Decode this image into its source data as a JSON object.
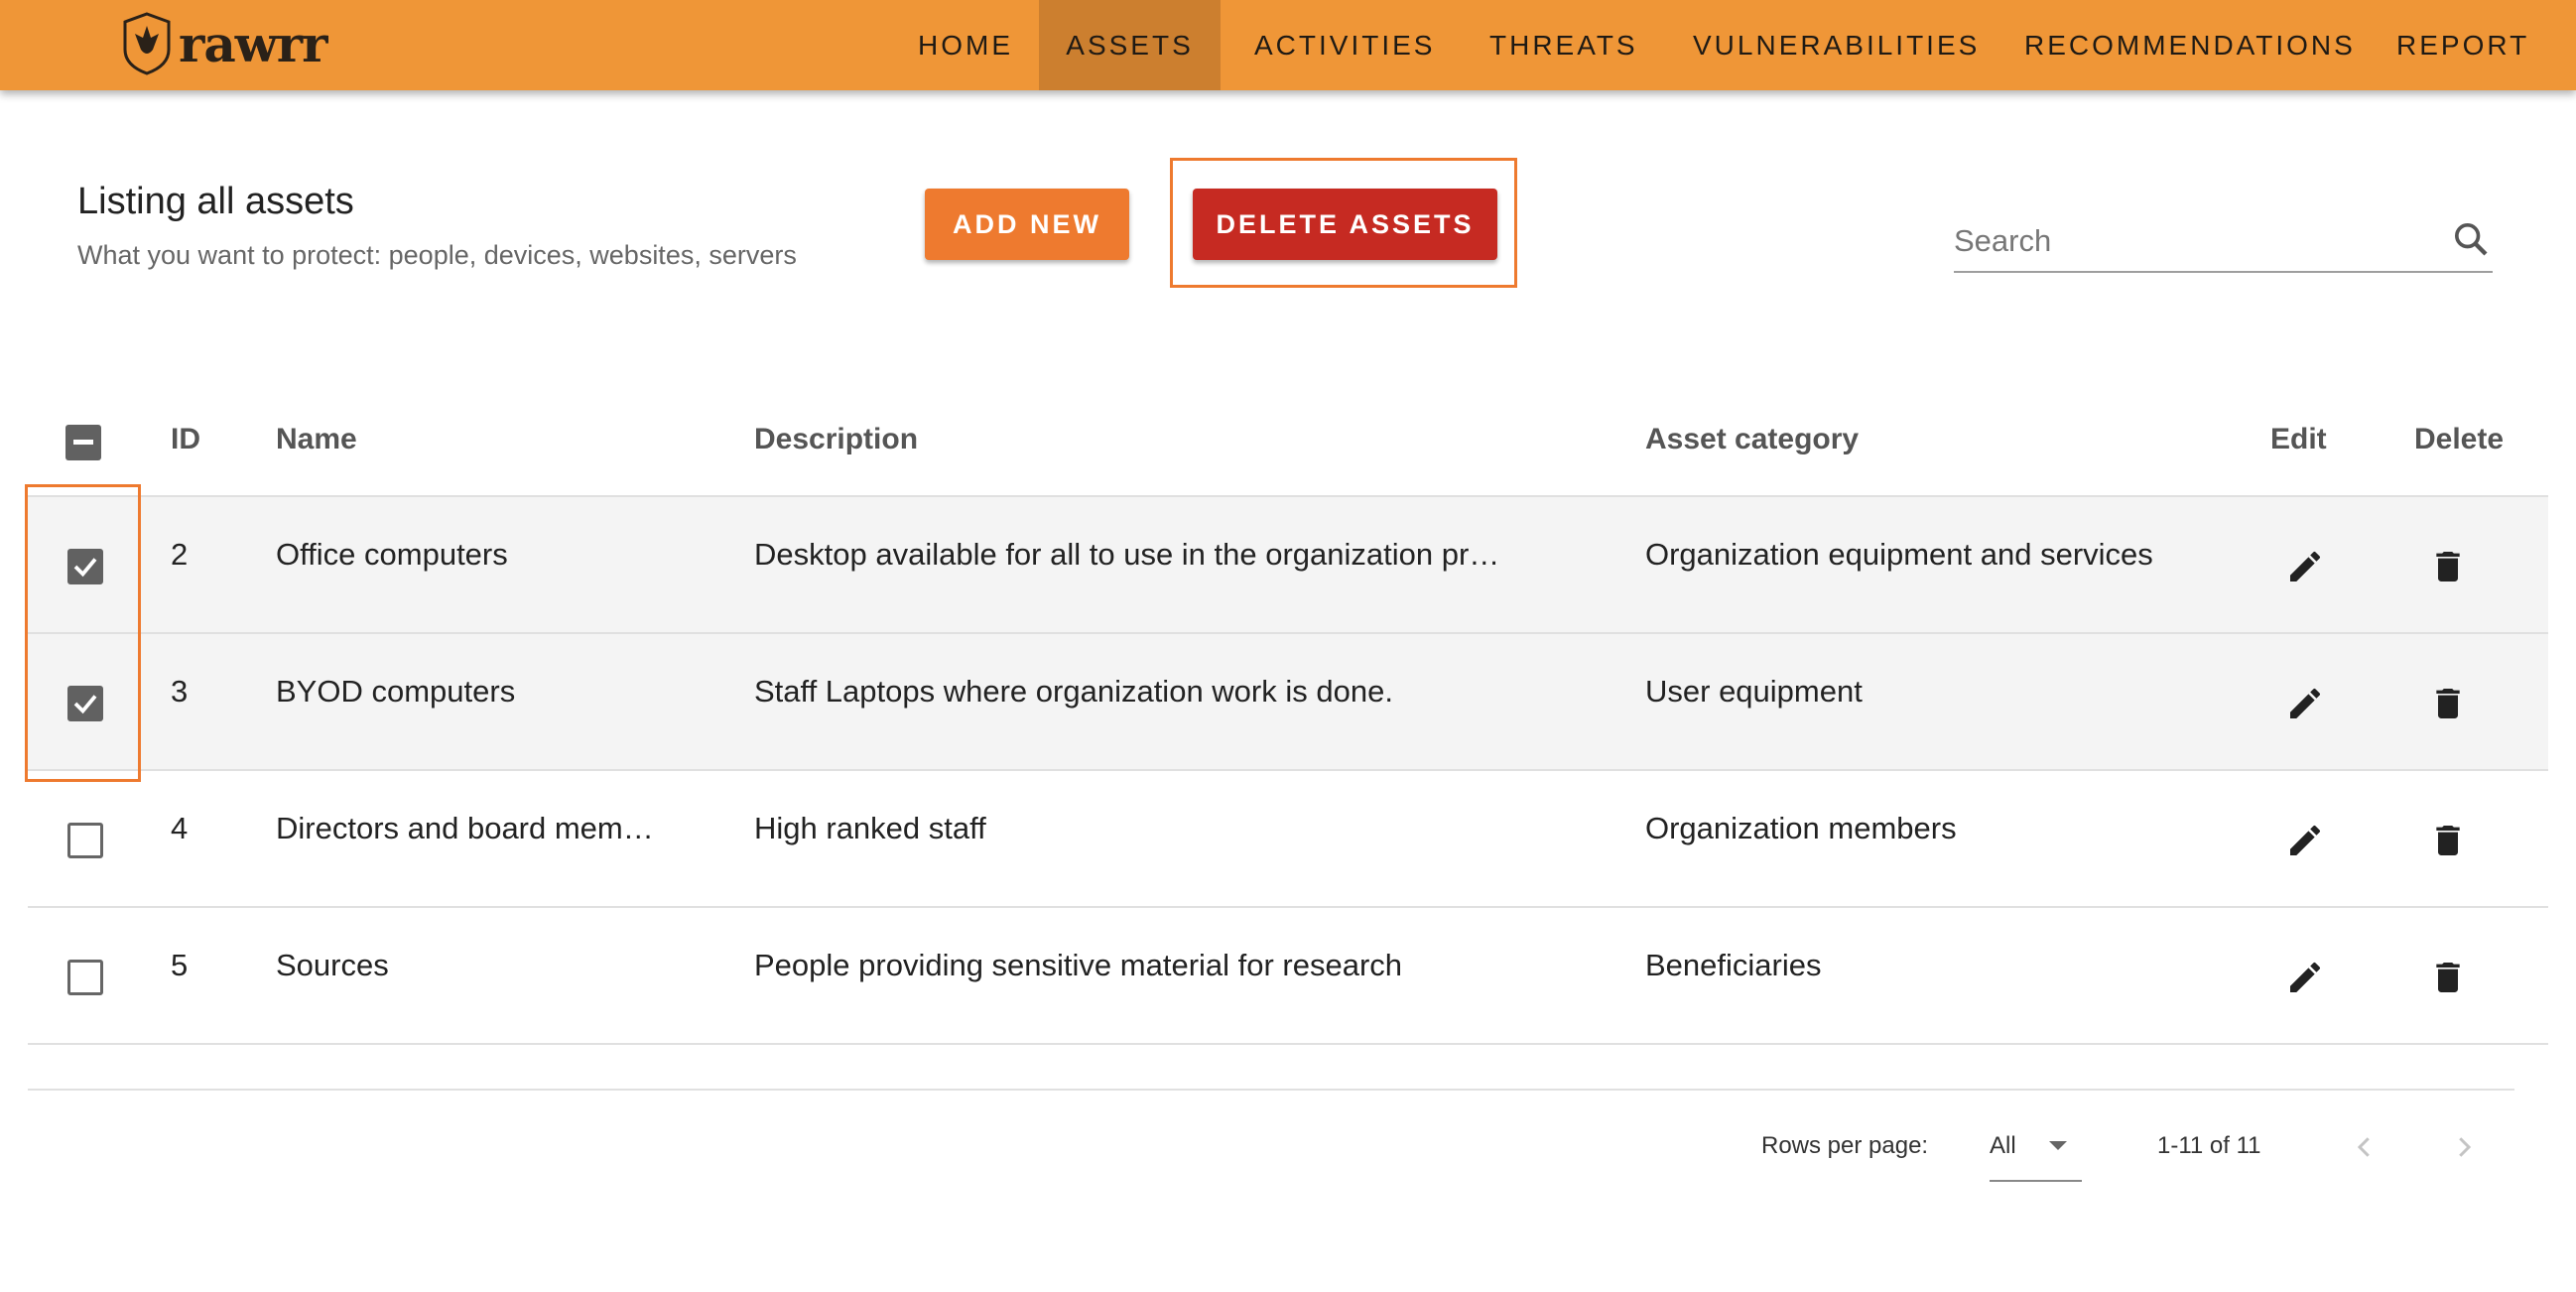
{
  "app": {
    "logo_text": "rawrr"
  },
  "nav": [
    {
      "label": "HOME"
    },
    {
      "label": "ASSETS",
      "active": true
    },
    {
      "label": "ACTIVITIES"
    },
    {
      "label": "THREATS"
    },
    {
      "label": "VULNERABILITIES"
    },
    {
      "label": "RECOMMENDATIONS"
    },
    {
      "label": "REPORT"
    }
  ],
  "page": {
    "title": "Listing all assets",
    "subtitle": "What you want to protect: people, devices, websites, servers"
  },
  "buttons": {
    "add_new": "ADD NEW",
    "delete_assets": "DELETE ASSETS"
  },
  "search": {
    "placeholder": "Search"
  },
  "table": {
    "headers": {
      "id": "ID",
      "name": "Name",
      "description": "Description",
      "category": "Asset category",
      "edit": "Edit",
      "delete": "Delete"
    },
    "rows": [
      {
        "id": "2",
        "name": "Office computers",
        "description": "Desktop available for all to use in the organization pr…",
        "category": "Organization equipment and services",
        "checked": true
      },
      {
        "id": "3",
        "name": "BYOD computers",
        "description": "Staff Laptops where organization work is done.",
        "category": "User equipment",
        "checked": true
      },
      {
        "id": "4",
        "name": "Directors and board mem…",
        "description": "High ranked staff",
        "category": "Organization members",
        "checked": false
      },
      {
        "id": "5",
        "name": "Sources",
        "description": "People providing sensitive material for research",
        "category": "Beneficiaries",
        "checked": false
      }
    ]
  },
  "pagination": {
    "rows_per_page_label": "Rows per page:",
    "rows_per_page_value": "All",
    "range": "1-11 of 11"
  },
  "colors": {
    "header": "#ef9637",
    "active_tab": "#cc7f2f",
    "add": "#ee7a2f",
    "delete": "#c62a22"
  }
}
